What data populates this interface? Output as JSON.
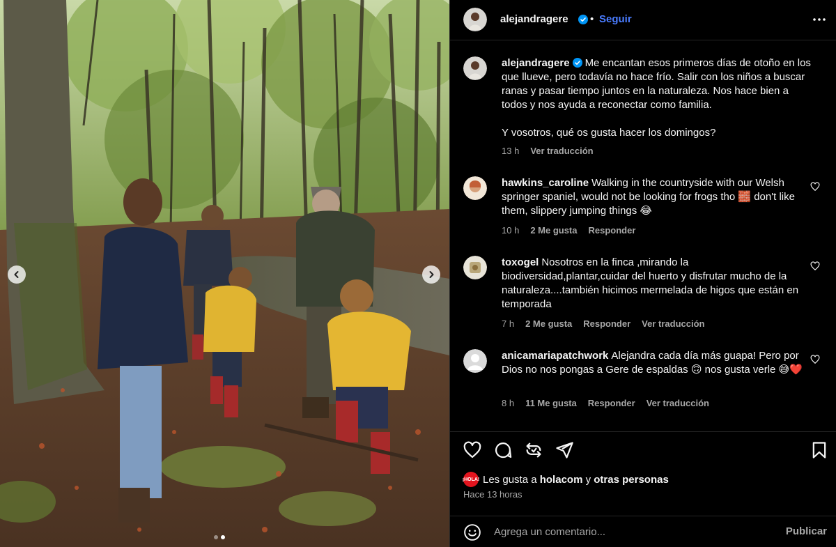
{
  "post": {
    "author": "alejandragere",
    "follow_label": "Seguir",
    "separator": "•",
    "caption": "Me encantan esos primeros días de otoño en los que llueve, pero todavía no hace frío. Salir con los niños a buscar ranas y pasar tiempo juntos en la naturaleza. Nos hace bien a todos y nos ayuda a reconectar como familia.",
    "caption_question": "Y vosotros, qué os gusta hacer los domingos?",
    "caption_time": "13 h",
    "caption_translate": "Ver traducción"
  },
  "comments": [
    {
      "user": "hawkins_caroline",
      "text": "Walking in the countryside with our Welsh springer spaniel, would not be looking for frogs tho 🧱 don't like them, slippery jumping things 😂",
      "time": "10 h",
      "likes": "2 Me gusta",
      "reply": "Responder",
      "translate": ""
    },
    {
      "user": "toxogel",
      "text": "Nosotros en la finca ,mirando la biodiversidad,plantar,cuidar del huerto y disfrutar mucho de la naturaleza....también hicimos mermelada de higos que están en temporada",
      "time": "7 h",
      "likes": "2 Me gusta",
      "reply": "Responder",
      "translate": "Ver traducción"
    },
    {
      "user": "anicamariapatchwork",
      "text": "Alejandra cada día más guapa! Pero por Dios no nos pongas a Gere de espaldas 🙃 nos gusta verle 😅❤️",
      "time": "8 h",
      "likes": "11 Me gusta",
      "reply": "Responder",
      "translate": "Ver traducción"
    }
  ],
  "engagement": {
    "liked_by_prefix": "Les gusta a",
    "liked_by_user": "holacom",
    "liked_by_and": "y",
    "liked_by_others": "otras personas",
    "liker_badge": "¡HOLA!",
    "posted_ago": "Hace 13 horas"
  },
  "composer": {
    "placeholder": "Agrega un comentario...",
    "publish_label": "Publicar"
  },
  "carousel": {
    "slide_count": 2,
    "active_index": 1
  },
  "colors": {
    "background": "#000000",
    "follow_blue": "#4a7cff",
    "verified_blue": "#0095f6",
    "muted_text": "#a8a8a8"
  },
  "icons": [
    "chevron-left-icon",
    "chevron-right-icon",
    "verified-badge-icon",
    "more-icon",
    "heart-icon",
    "comment-icon",
    "repost-icon",
    "share-icon",
    "bookmark-icon",
    "emoji-icon"
  ]
}
